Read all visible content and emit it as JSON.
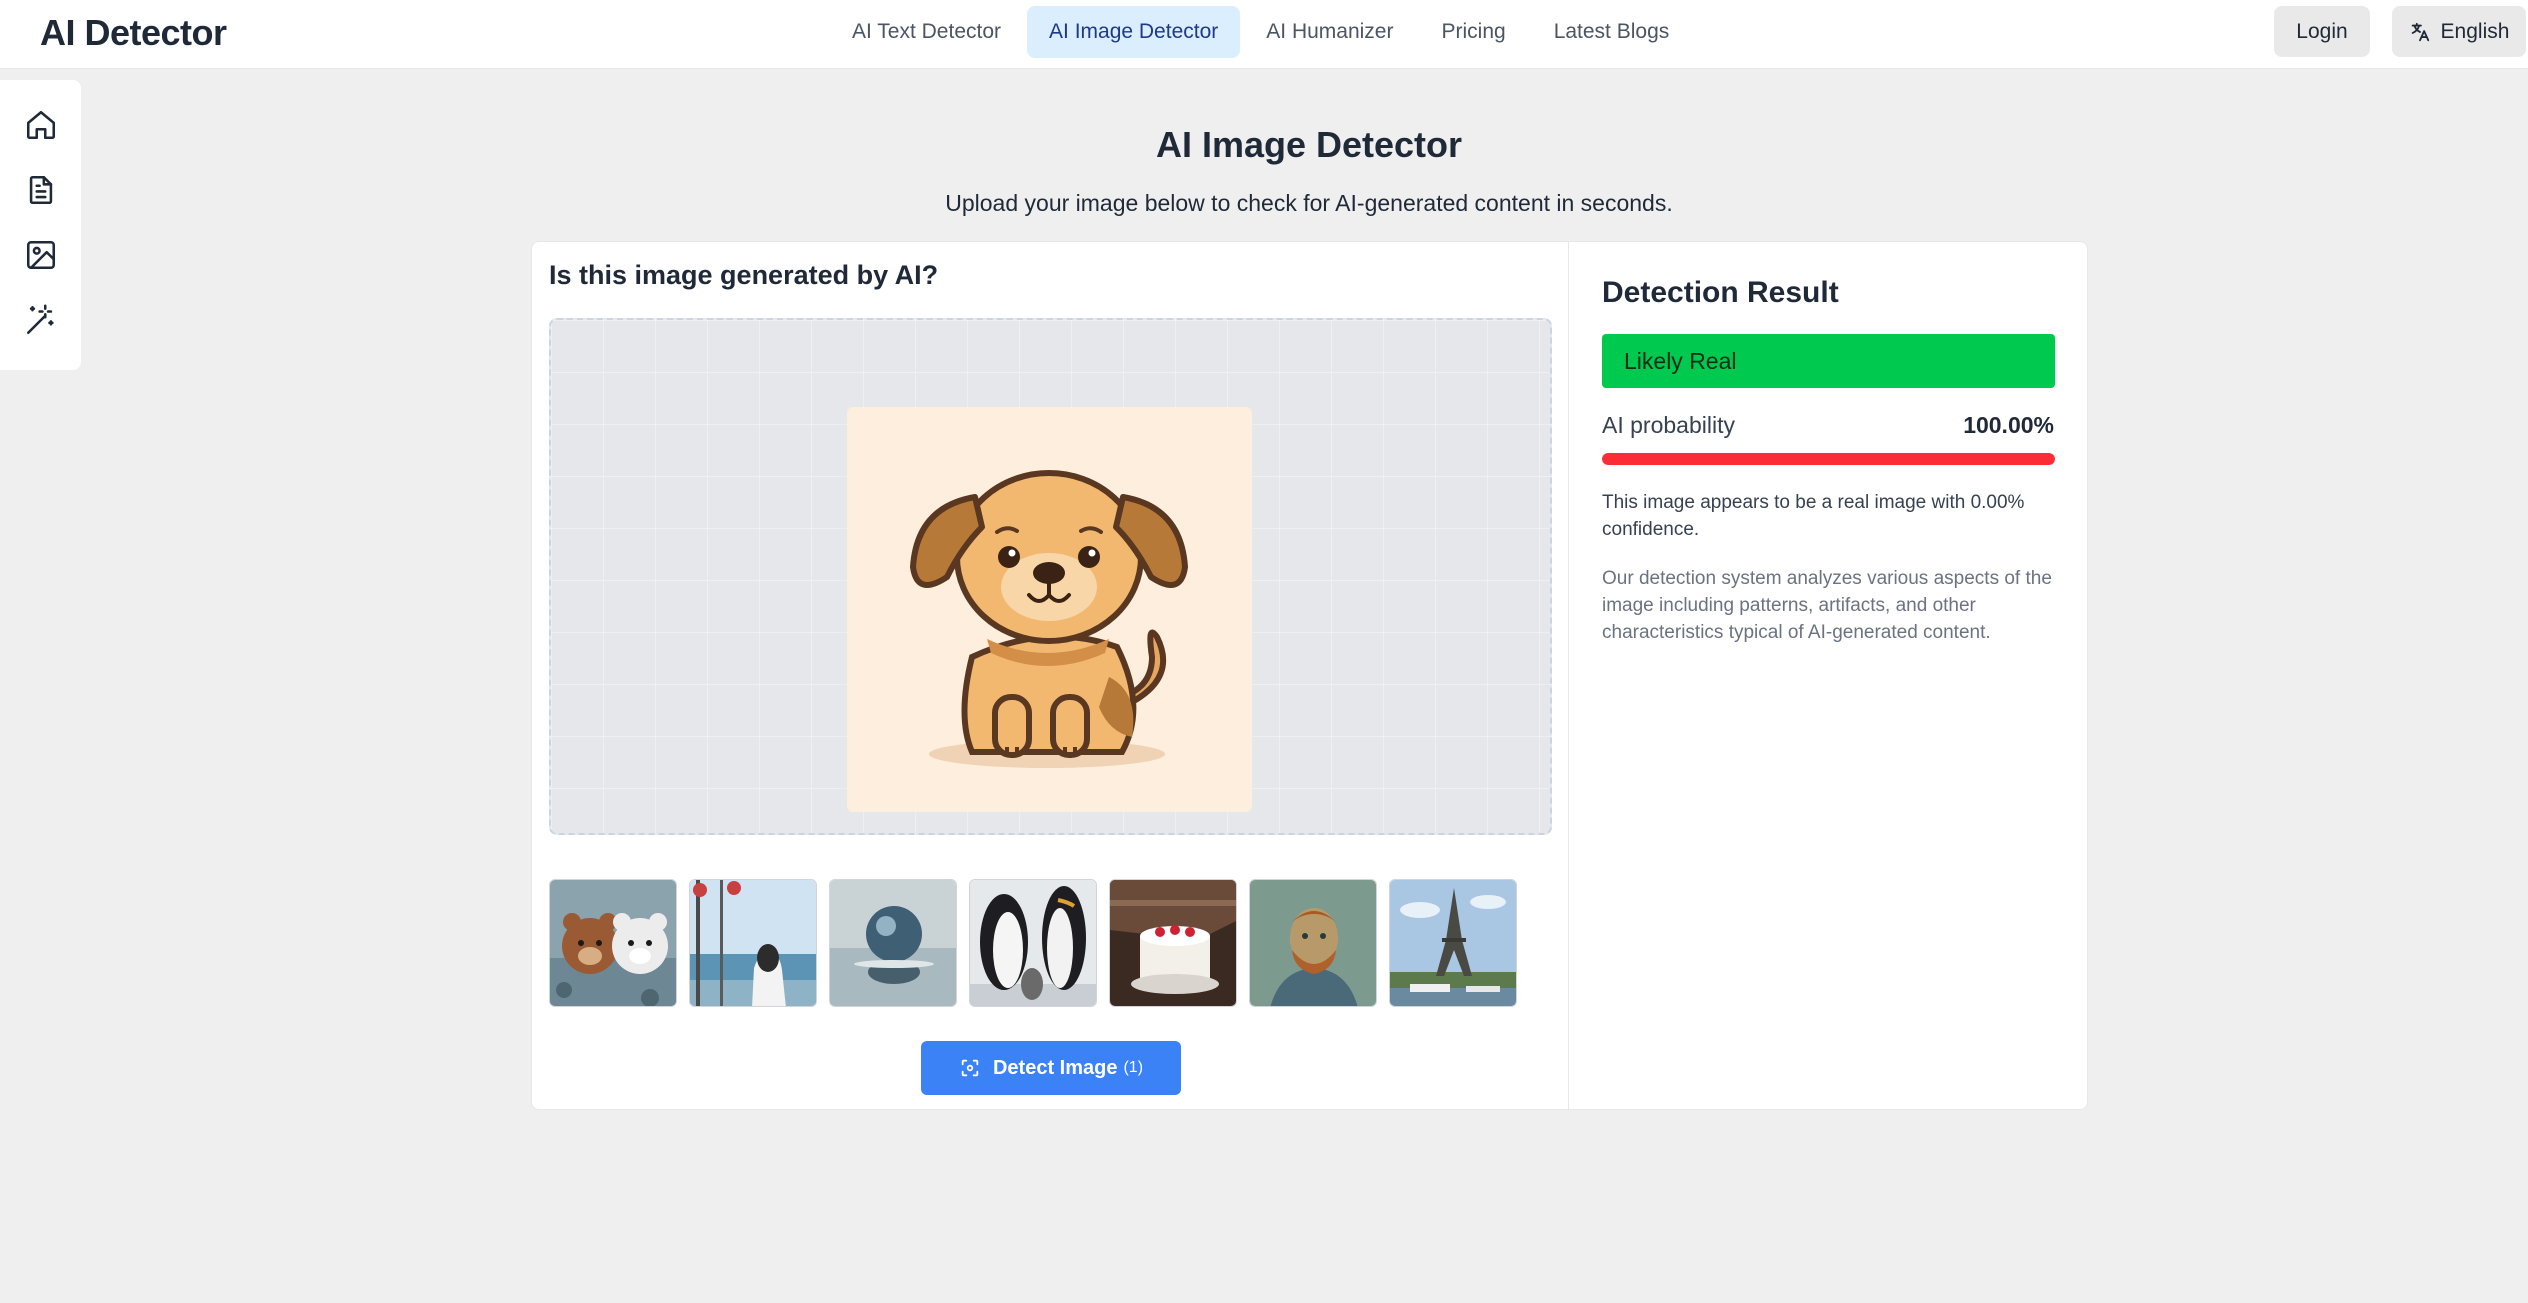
{
  "header": {
    "brand": "AI Detector",
    "nav": [
      {
        "label": "AI Text Detector",
        "active": false
      },
      {
        "label": "AI Image Detector",
        "active": true
      },
      {
        "label": "AI Humanizer",
        "active": false
      },
      {
        "label": "Pricing",
        "active": false
      },
      {
        "label": "Latest Blogs",
        "active": false
      }
    ],
    "login_label": "Login",
    "language_label": "English",
    "language_icon": "translate-icon"
  },
  "sidebar": {
    "icons": [
      "home-icon",
      "document-icon",
      "image-icon",
      "magic-wand-icon"
    ]
  },
  "main": {
    "title": "AI Image Detector",
    "subtitle": "Upload your image below to check for AI-generated content in seconds."
  },
  "upload": {
    "question": "Is this image generated by AI?",
    "preview": "puppy-illustration",
    "samples": [
      "teddy-bears-in-water",
      "girl-by-sea",
      "glass-globe",
      "penguins",
      "cake",
      "van-gogh-portrait",
      "eiffel-tower"
    ],
    "detect_label": "Detect Image",
    "detect_count": "(1)"
  },
  "result": {
    "title": "Detection Result",
    "verdict": "Likely Real",
    "probability_label": "AI probability",
    "probability_value": "100.00%",
    "probability_fraction": 1.0,
    "description": "This image appears to be a real image with 0.00% confidence.",
    "explanation": "Our detection system analyzes various aspects of the image including patterns, artifacts, and other characteristics typical of AI-generated content.",
    "colors": {
      "verdict": "#00c950",
      "bar": "#fb2c36",
      "accent": "#3b82f6"
    }
  }
}
